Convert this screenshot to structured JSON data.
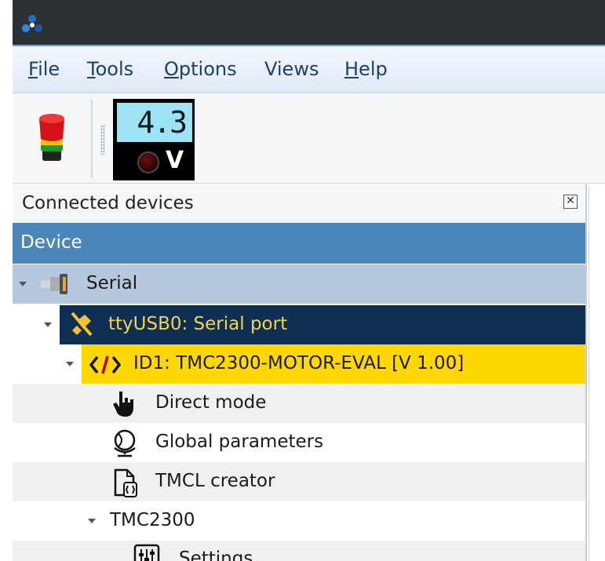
{
  "menu": {
    "file": {
      "u": "F",
      "rest": "ile"
    },
    "tools": {
      "u": "T",
      "rest": "ools"
    },
    "options": {
      "u": "O",
      "rest": "ptions"
    },
    "views": {
      "u": "",
      "rest": "Views"
    },
    "help": {
      "u": "H",
      "rest": "elp"
    }
  },
  "toolbar": {
    "voltage_value": "4.3",
    "voltage_unit": "V"
  },
  "dock": {
    "title": "Connected devices",
    "close_symbol": "✕"
  },
  "tree": {
    "column_header": "Device",
    "rows": [
      {
        "label": "Serial",
        "icon": "serial-plug-icon"
      },
      {
        "label": "ttyUSB0: Serial port",
        "icon": "disconnected-plug-icon"
      },
      {
        "label": "ID1: TMC2300-MOTOR-EVAL [V 1.00]",
        "icon": "code-brackets-icon"
      },
      {
        "label": "Direct mode",
        "icon": "hand-pointer-icon"
      },
      {
        "label": "Global parameters",
        "icon": "globe-icon"
      },
      {
        "label": "TMCL creator",
        "icon": "document-icon"
      },
      {
        "label": "TMC2300",
        "icon": ""
      },
      {
        "label": "Settings",
        "icon": "sliders-icon"
      }
    ]
  },
  "colors": {
    "serial_row_bg": "#b5c8de",
    "port_row_bg": "#0e2e52",
    "port_row_text": "#f4d64a",
    "module_row_bg": "#ffd800",
    "alt_row_bg": "#f0f0f0",
    "header_bg": "#4b86b9"
  }
}
